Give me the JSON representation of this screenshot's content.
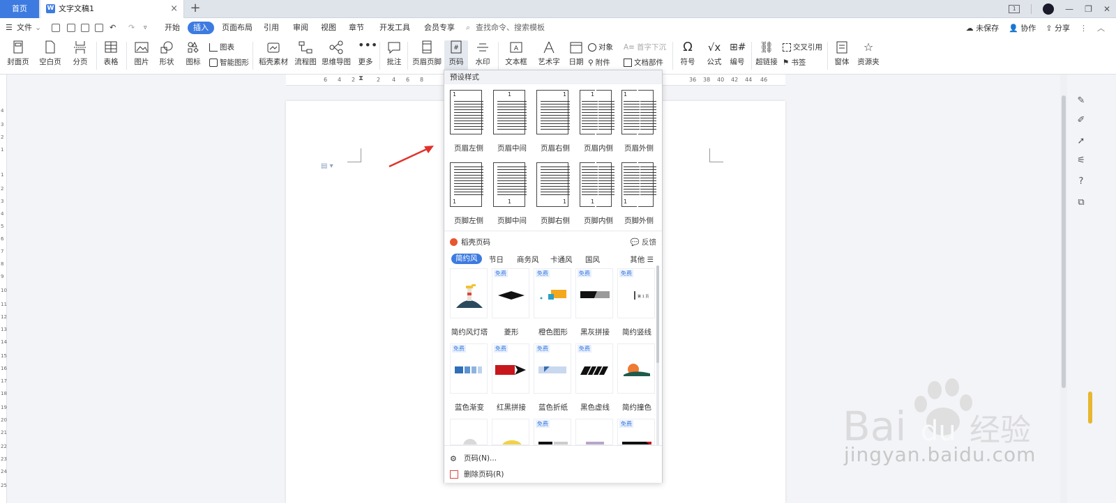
{
  "titlebar": {
    "home_tab": "首页",
    "doc_tab": "文字文稿1",
    "new_tab": "+",
    "close": "×",
    "win_mode_badge": "1"
  },
  "menubar": {
    "file": "文件",
    "items": [
      "开始",
      "插入",
      "页面布局",
      "引用",
      "审阅",
      "视图",
      "章节",
      "开发工具",
      "会员专享"
    ],
    "active": "插入",
    "search": "查找命令、搜索模板",
    "unsaved": "未保存",
    "collab": "协作",
    "share": "分享"
  },
  "ribbon": {
    "cover": "封面页",
    "blank": "空白页",
    "pagebreak": "分页",
    "table": "表格",
    "picture": "图片",
    "shape": "形状",
    "icon": "图标",
    "chart": "图表",
    "smartart": "智能图形",
    "docer_material": "稻壳素材",
    "flowchart": "流程图",
    "mindmap": "思维导图",
    "more": "更多",
    "comment": "批注",
    "header_footer": "页眉页脚",
    "page_number": "页码",
    "watermark": "水印",
    "textbox": "文本框",
    "wordart": "艺术字",
    "date": "日期",
    "object": "对象",
    "attachment": "附件",
    "dropcap": "首字下沉",
    "docparts": "文档部件",
    "symbol": "符号",
    "formula": "公式",
    "numbering": "编号",
    "hyperlink": "超链接",
    "crossref": "交叉引用",
    "bookmark": "书签",
    "form": "窗体",
    "resources": "资源夹"
  },
  "ruler": {
    "h_marks": [
      "6",
      "4",
      "2",
      "2",
      "4",
      "6",
      "8",
      "36",
      "38",
      "40",
      "42",
      "44",
      "46"
    ],
    "v_marks": [
      "4",
      "3",
      "2",
      "1",
      "1",
      "2",
      "3",
      "4",
      "5",
      "6",
      "7",
      "8",
      "9",
      "10",
      "11",
      "12",
      "13",
      "14",
      "15",
      "16",
      "17",
      "18",
      "19",
      "20",
      "21",
      "22",
      "23",
      "24",
      "25"
    ]
  },
  "dropdown": {
    "preset_title": "预设样式",
    "header_presets": [
      "页眉左侧",
      "页眉中间",
      "页眉右侧",
      "页眉内侧",
      "页眉外侧"
    ],
    "footer_presets": [
      "页脚左侧",
      "页脚中间",
      "页脚右侧",
      "页脚内侧",
      "页脚外侧"
    ],
    "page_digit": "1",
    "docer_title": "稻壳页码",
    "feedback": "反馈",
    "filters": [
      "简约风",
      "节日",
      "商务风",
      "卡通风",
      "国风"
    ],
    "filter_more": "其他",
    "free_badge": "免费",
    "templates_row1": [
      "简约风灯塔",
      "菱形",
      "橙色图形",
      "黑灰拼接",
      "简约竖线"
    ],
    "templates_row2": [
      "蓝色渐变",
      "红黑拼接",
      "蓝色折纸",
      "黑色虚线",
      "简约撞色"
    ],
    "tpl_sample_text": "第 1 页",
    "action_page_number": "页码(N)...",
    "action_delete": "删除页码(R)"
  },
  "watermark": {
    "brand": "Bai",
    "brand2": "du",
    "cn": "经验",
    "url": "jingyan.baidu.com"
  },
  "colors": {
    "accent": "#3d7be0",
    "arrow": "#e0322c"
  }
}
